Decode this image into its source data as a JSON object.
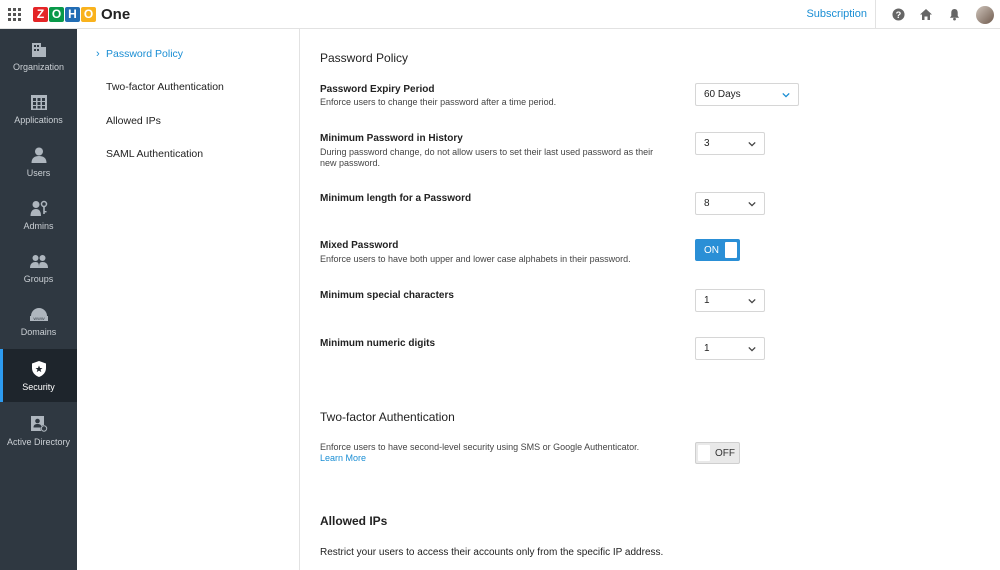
{
  "topbar": {
    "brand_text": "One",
    "logo_letters": [
      "Z",
      "O",
      "H",
      "O"
    ],
    "logo_colors": [
      "#e42527",
      "#089949",
      "#226db4",
      "#f9b21d"
    ],
    "subscription_label": "Subscription",
    "icons": [
      "help-icon",
      "home-icon",
      "bell-icon"
    ]
  },
  "leftnav": {
    "items": [
      {
        "label": "Organization",
        "icon": "organization-icon"
      },
      {
        "label": "Applications",
        "icon": "applications-icon"
      },
      {
        "label": "Users",
        "icon": "user-icon"
      },
      {
        "label": "Admins",
        "icon": "admins-icon"
      },
      {
        "label": "Groups",
        "icon": "groups-icon"
      },
      {
        "label": "Domains",
        "icon": "domains-icon"
      },
      {
        "label": "Security",
        "icon": "shield-icon",
        "active": true
      },
      {
        "label": "Active Directory",
        "icon": "active-directory-icon"
      }
    ]
  },
  "subnav": {
    "items": [
      {
        "label": "Password Policy",
        "active": true
      },
      {
        "label": "Two-factor Authentication"
      },
      {
        "label": "Allowed IPs"
      },
      {
        "label": "SAML Authentication"
      }
    ]
  },
  "password_policy": {
    "title": "Password Policy",
    "expiry": {
      "title": "Password Expiry Period",
      "desc": "Enforce users to change their password after a time period.",
      "value": "60 Days"
    },
    "history": {
      "title": "Minimum Password in History",
      "desc": "During password change, do not allow users to set their last used password as their new password.",
      "value": "3"
    },
    "min_length": {
      "title": "Minimum length for a Password",
      "value": "8"
    },
    "mixed": {
      "title": "Mixed Password",
      "desc": "Enforce users to have both upper and lower case alphabets in their password.",
      "toggle": "ON"
    },
    "special": {
      "title": "Minimum special characters",
      "value": "1"
    },
    "numeric": {
      "title": "Minimum numeric digits",
      "value": "1"
    }
  },
  "two_factor": {
    "title": "Two-factor Authentication",
    "desc": "Enforce users to have second-level security using SMS or Google Authenticator.",
    "learn_more": "Learn More",
    "toggle": "OFF"
  },
  "allowed_ips": {
    "title": "Allowed IPs",
    "desc": "Restrict your users to access their accounts only from the specific IP address."
  },
  "colors": {
    "accent": "#1a8ed4",
    "nav_bg": "#2f3841",
    "toggle_on": "#2a8fd6"
  }
}
